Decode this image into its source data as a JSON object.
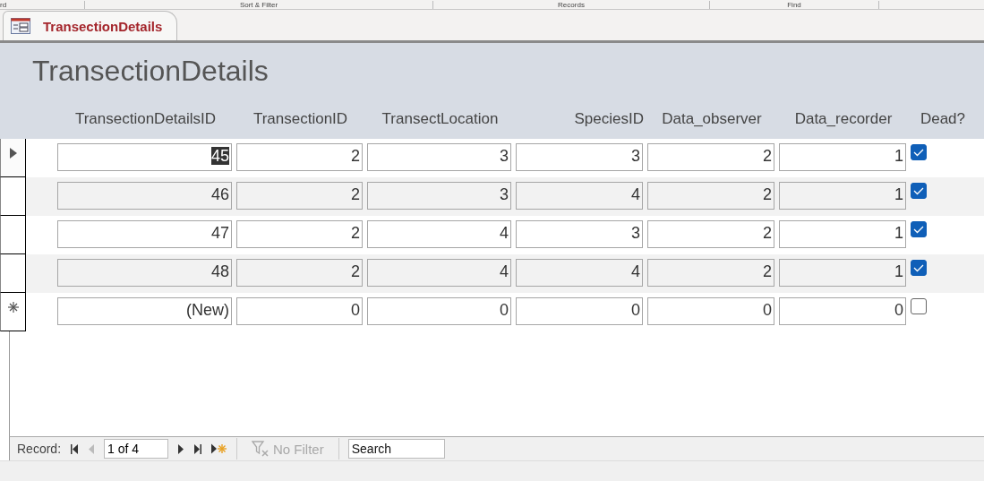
{
  "ribbon_groups": [
    "rd",
    "Sort & Filter",
    "Records",
    "Find"
  ],
  "tabs": [
    {
      "label": "TransectionDetails",
      "selected": true
    }
  ],
  "form": {
    "title": "TransectionDetails",
    "columns": [
      "TransectionDetailsID",
      "TransectionID",
      "TransectLocation",
      "SpeciesID",
      "Data_observer",
      "Data_recorder",
      "Dead?"
    ],
    "rows": [
      {
        "kind": "record",
        "selected": true,
        "values": [
          "45",
          "2",
          "3",
          "3",
          "2",
          "1"
        ],
        "dead": true
      },
      {
        "kind": "record",
        "selected": false,
        "values": [
          "46",
          "2",
          "3",
          "4",
          "2",
          "1"
        ],
        "dead": true
      },
      {
        "kind": "record",
        "selected": false,
        "values": [
          "47",
          "2",
          "4",
          "3",
          "2",
          "1"
        ],
        "dead": true
      },
      {
        "kind": "record",
        "selected": false,
        "values": [
          "48",
          "2",
          "4",
          "4",
          "2",
          "1"
        ],
        "dead": true
      },
      {
        "kind": "new",
        "selected": false,
        "values": [
          "(New)",
          "0",
          "0",
          "0",
          "0",
          "0"
        ],
        "dead": false
      }
    ]
  },
  "navigation": {
    "label": "Record:",
    "position": "1 of 4",
    "filter": {
      "label": "No Filter",
      "disabled": true
    },
    "search": {
      "placeholder": "Search"
    }
  }
}
